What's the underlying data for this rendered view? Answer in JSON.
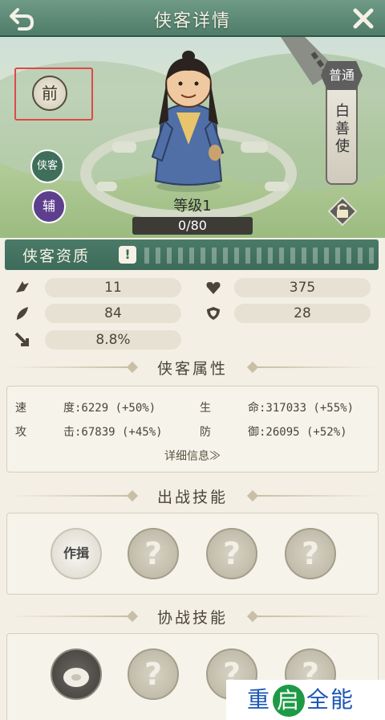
{
  "header": {
    "title": "侠客详情"
  },
  "hero": {
    "position_badge": "前",
    "role_xia": "侠客",
    "role_fu": "辅",
    "level_label": "等级1",
    "exp_text": "0/80",
    "rarity_grade": "普通",
    "rarity_name": [
      "白",
      "善",
      "使"
    ]
  },
  "aptitude": {
    "title": "侠客资质",
    "info_mark": "!",
    "stats": [
      {
        "icon": "attack-claw-icon",
        "value": "11"
      },
      {
        "icon": "heart-icon",
        "value": "375"
      },
      {
        "icon": "leaf-speed-icon",
        "value": "84"
      },
      {
        "icon": "shield-icon",
        "value": "28"
      },
      {
        "icon": "arrow-crit-icon",
        "value": "8.8%"
      }
    ]
  },
  "attributes": {
    "title": "侠客属性",
    "rows": [
      [
        "速",
        "度:6229 (+50%)",
        "生",
        "命:317033 (+55%)"
      ],
      [
        "攻",
        "击:67839 (+45%)",
        "防",
        "御:26095 (+52%)"
      ]
    ],
    "detail_link": "详细信息≫"
  },
  "battle_skills": {
    "title": "出战技能",
    "first_skill": "作揖",
    "placeholder": "?"
  },
  "assist_skills": {
    "title": "协战技能",
    "placeholder": "?"
  },
  "watermark": {
    "left": "重",
    "mid": "启",
    "right": "全能"
  }
}
